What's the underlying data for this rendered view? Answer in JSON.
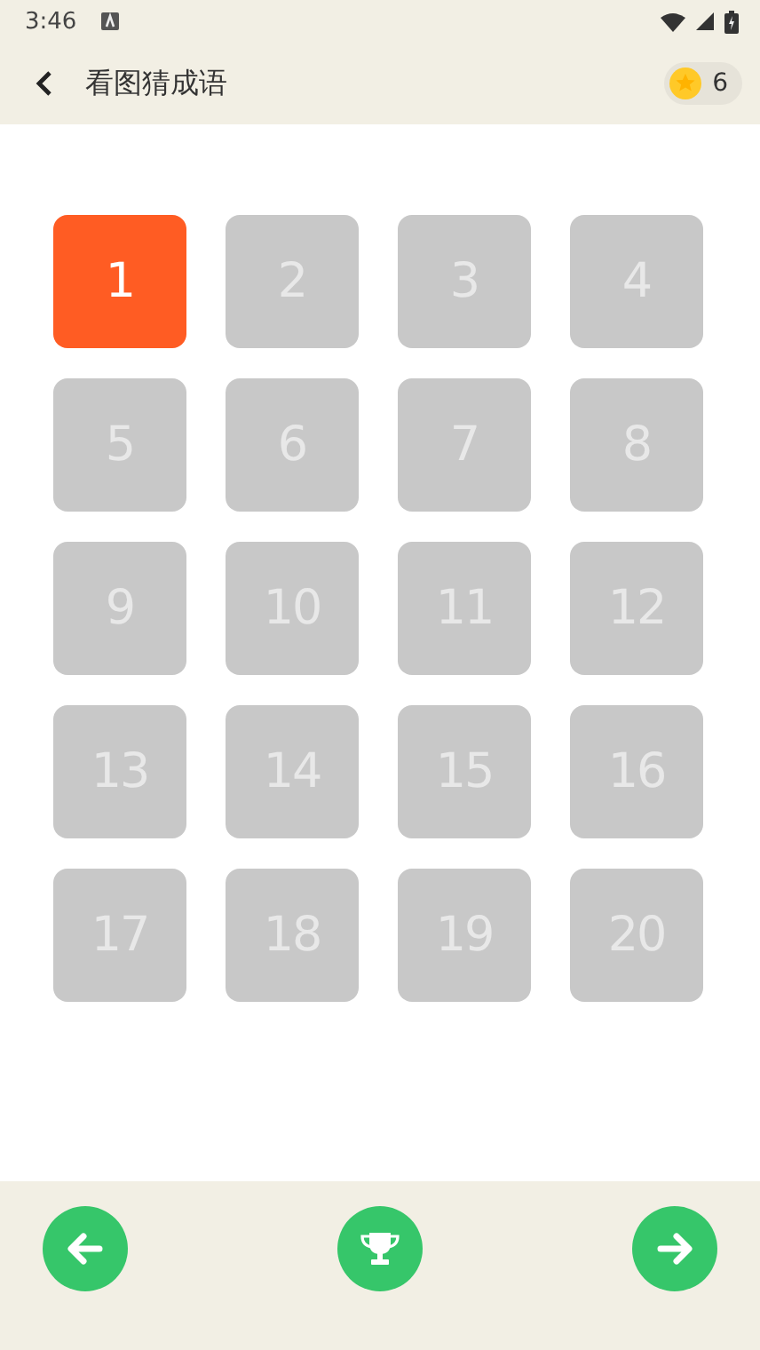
{
  "status_bar": {
    "time": "3:46"
  },
  "toolbar": {
    "title": "看图猜成语",
    "coins": "6"
  },
  "levels": [
    {
      "label": "1",
      "selected": true
    },
    {
      "label": "2",
      "selected": false
    },
    {
      "label": "3",
      "selected": false
    },
    {
      "label": "4",
      "selected": false
    },
    {
      "label": "5",
      "selected": false
    },
    {
      "label": "6",
      "selected": false
    },
    {
      "label": "7",
      "selected": false
    },
    {
      "label": "8",
      "selected": false
    },
    {
      "label": "9",
      "selected": false
    },
    {
      "label": "10",
      "selected": false
    },
    {
      "label": "11",
      "selected": false
    },
    {
      "label": "12",
      "selected": false
    },
    {
      "label": "13",
      "selected": false
    },
    {
      "label": "14",
      "selected": false
    },
    {
      "label": "15",
      "selected": false
    },
    {
      "label": "16",
      "selected": false
    },
    {
      "label": "17",
      "selected": false
    },
    {
      "label": "18",
      "selected": false
    },
    {
      "label": "19",
      "selected": false
    },
    {
      "label": "20",
      "selected": false
    }
  ]
}
